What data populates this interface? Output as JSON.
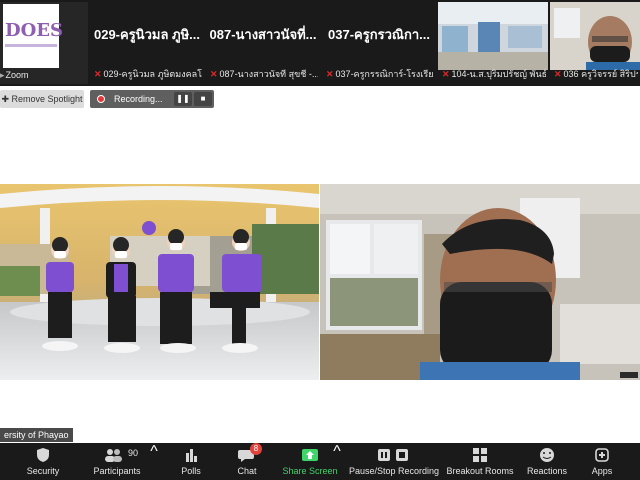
{
  "strip": {
    "tiles": [
      {
        "caption": "Zoom"
      },
      {
        "big": "029-ครูนิวมล ภูษิ...",
        "caption": "029-ครูนิวมล ภูษิตมงคลโช..."
      },
      {
        "big": "087-นางสาวนัจที่...",
        "caption": "087-นางสาวนัจที สุขชี -..."
      },
      {
        "big": "037-ครูกรวณิกา...",
        "caption": "037-ครูกรรณิการ์-โรงเรีย..."
      },
      {
        "caption": "104-น.ส.ปุริมปรัชญ์ พันธ์..."
      },
      {
        "caption": "036 ครูวิจรรย์ สิริประเ..."
      }
    ]
  },
  "spotlight": {
    "remove_label": "Remove Spotlight"
  },
  "recording": {
    "status": "Recording...",
    "pause_icon": "pause-icon",
    "stop_icon": "stop-icon"
  },
  "main": {
    "left_label": "ersity of Phayao"
  },
  "toolbar": {
    "security": "Security",
    "participants": "Participants",
    "participants_count": "90",
    "polls": "Polls",
    "chat": "Chat",
    "chat_badge": "8",
    "share": "Share Screen",
    "recording": "Pause/Stop Recording",
    "breakout": "Breakout Rooms",
    "reactions": "Reactions",
    "apps": "Apps"
  },
  "colors": {
    "accent_green": "#3fd46a",
    "record_red": "#e03a3a",
    "toolbar_bg": "#1a1a1a",
    "shirt_purple": "#7e4fd0"
  }
}
